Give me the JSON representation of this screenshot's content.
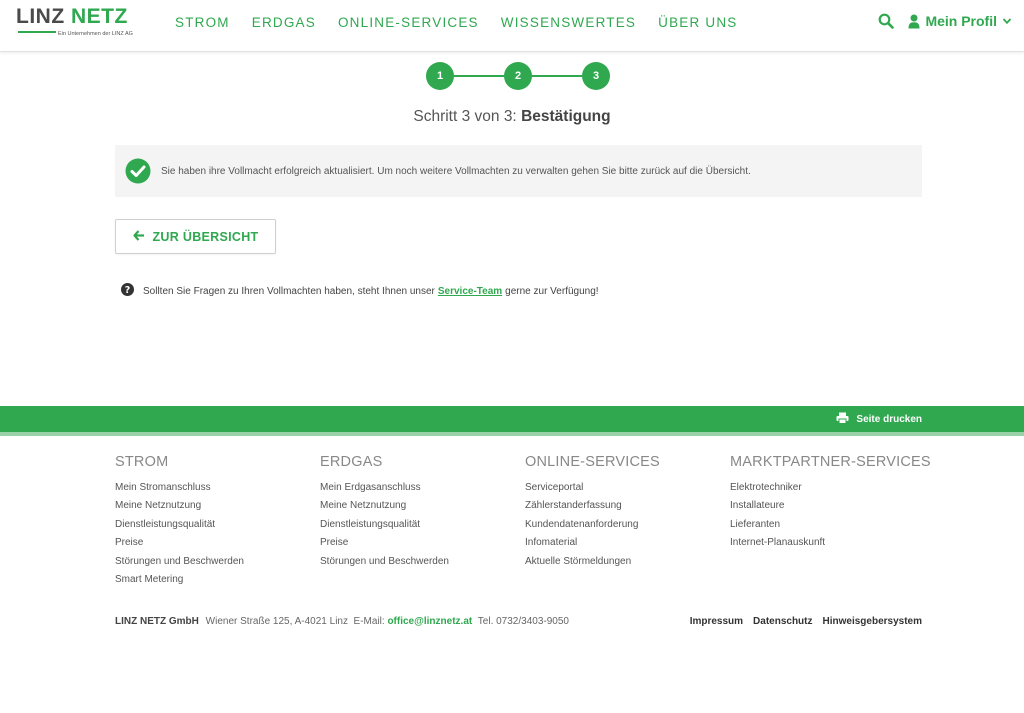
{
  "header": {
    "logo_linz": "LINZ",
    "logo_netz": "NETZ",
    "logo_sub": "Ein Unternehmen der LINZ AG",
    "nav": [
      "STROM",
      "ERDGAS",
      "ONLINE-SERVICES",
      "WISSENSWERTES",
      "ÜBER UNS"
    ],
    "profile_label": "Mein Profil"
  },
  "stepper": {
    "steps": [
      "1",
      "2",
      "3"
    ],
    "title_prefix": "Schritt 3 von 3: ",
    "title_bold": "Bestätigung"
  },
  "success": {
    "message": "Sie haben ihre Vollmacht erfolgreich aktualisiert. Um noch weitere Vollmachten zu verwalten gehen Sie bitte zurück auf die Übersicht."
  },
  "back_button": {
    "label": "ZUR ÜBERSICHT"
  },
  "help": {
    "before": "Sollten Sie Fragen zu Ihren Vollmachten haben, steht Ihnen unser",
    "link": "Service-Team",
    "after": "gerne zur Verfügung!"
  },
  "band": {
    "print_label": "Seite drucken"
  },
  "footer": {
    "columns": [
      {
        "title": "STROM",
        "items": [
          "Mein Stromanschluss",
          "Meine Netznutzung",
          "Dienstleistungsqualität",
          "Preise",
          "Störungen und Beschwerden",
          "Smart Metering"
        ]
      },
      {
        "title": "ERDGAS",
        "items": [
          "Mein Erdgasanschluss",
          "Meine Netznutzung",
          "Dienstleistungsqualität",
          "Preise",
          "Störungen und Beschwerden"
        ]
      },
      {
        "title": "ONLINE-SERVICES",
        "items": [
          "Serviceportal",
          "Zählerstanderfassung",
          "Kundendatenanforderung",
          "Infomaterial",
          "Aktuelle Störmeldungen"
        ]
      },
      {
        "title": "MARKTPARTNER-SERVICES",
        "items": [
          "Elektrotechniker",
          "Installateure",
          "Lieferanten",
          "Internet-Planauskunft"
        ]
      }
    ],
    "company": "LINZ NETZ GmbH",
    "address": "Wiener Straße 125, A-4021 Linz",
    "email_label": "E-Mail:",
    "email": "office@linznetz.at",
    "phone": "Tel. 0732/3403-9050",
    "legal": [
      "Impressum",
      "Datenschutz",
      "Hinweisgebersystem"
    ]
  },
  "colors": {
    "brand_green": "#2fa84f",
    "light_green": "#9ad1a8",
    "box_bg": "#f4f4f4"
  }
}
